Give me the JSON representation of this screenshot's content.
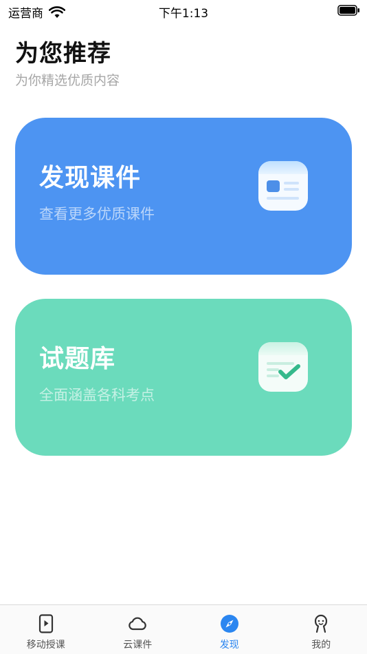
{
  "status_bar": {
    "carrier": "运营商",
    "time": "下午1:13"
  },
  "header": {
    "title": "为您推荐",
    "subtitle": "为你精选优质内容"
  },
  "cards": [
    {
      "title": "发现课件",
      "description": "查看更多优质课件",
      "color": "#4d94f2",
      "icon": "courseware-card-icon"
    },
    {
      "title": "试题库",
      "description": "全面涵盖各科考点",
      "color": "#6bdbbc",
      "icon": "checklist-icon"
    }
  ],
  "tab_bar": {
    "active_color": "#2b86f0",
    "items": [
      {
        "label": "移动授课",
        "icon": "mobile-play-icon",
        "active": false
      },
      {
        "label": "云课件",
        "icon": "cloud-icon",
        "active": false
      },
      {
        "label": "发现",
        "icon": "compass-icon",
        "active": true
      },
      {
        "label": "我的",
        "icon": "user-icon",
        "active": false
      }
    ]
  }
}
